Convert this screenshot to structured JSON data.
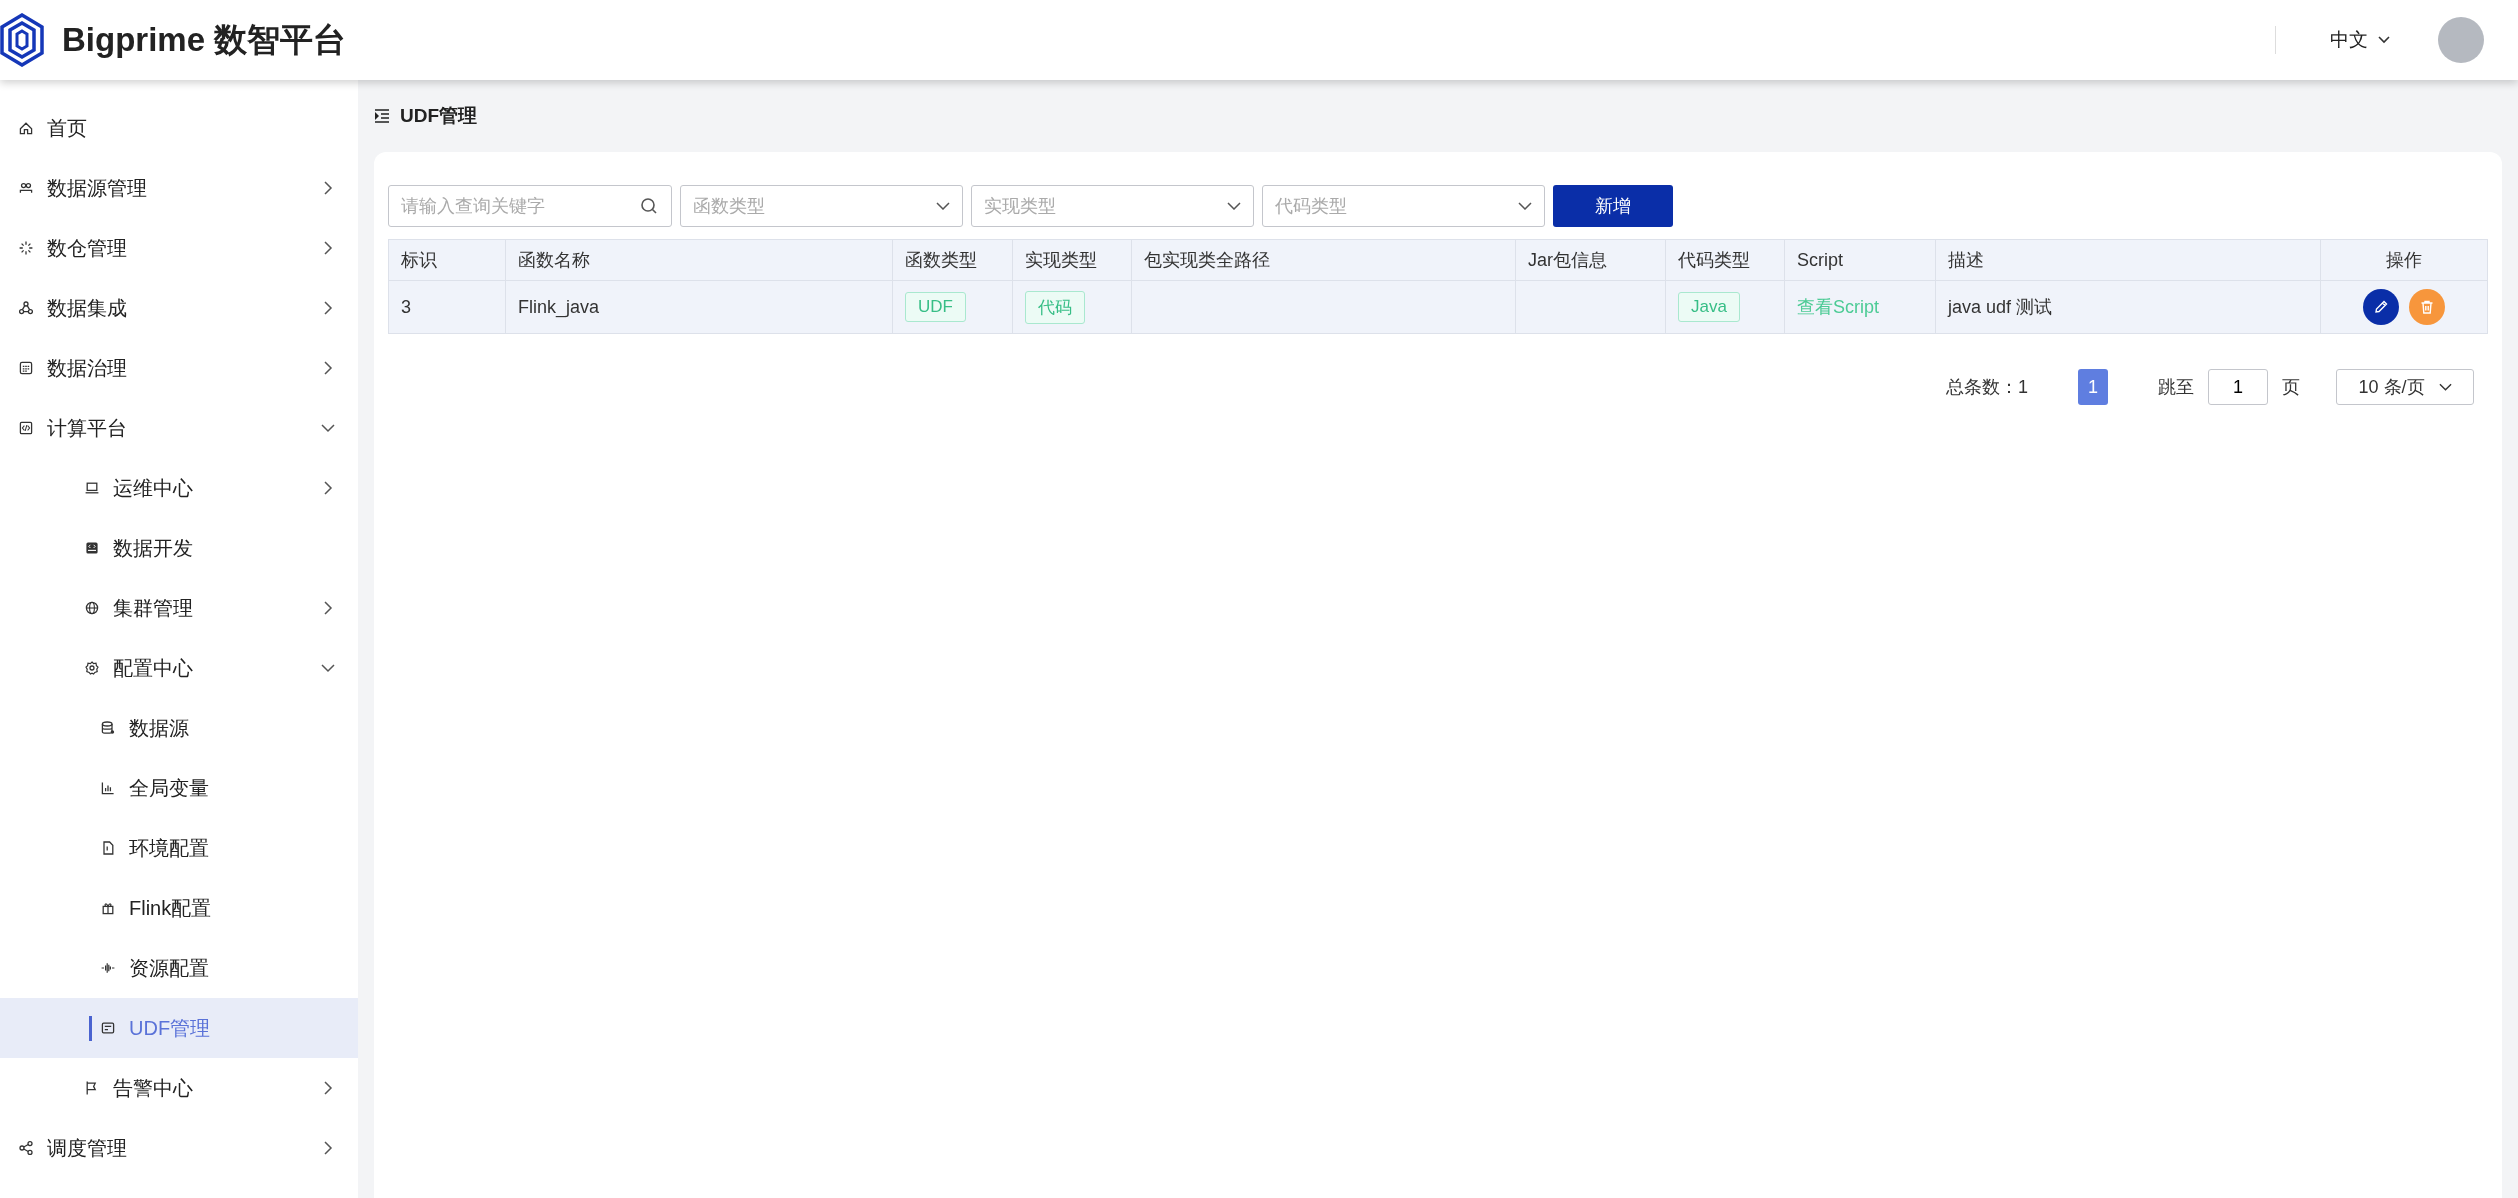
{
  "header": {
    "title": "Bigprime 数智平台",
    "language": "中文"
  },
  "sidebar": {
    "items": [
      {
        "label": "首页",
        "selected": false
      },
      {
        "label": "数据源管理",
        "expanded": false,
        "selected": false
      },
      {
        "label": "数仓管理",
        "expanded": false,
        "selected": false
      },
      {
        "label": "数据集成",
        "expanded": false,
        "selected": false
      },
      {
        "label": "数据治理",
        "expanded": false,
        "selected": false
      },
      {
        "label": "计算平台",
        "expanded": true,
        "selected": false,
        "children": [
          {
            "label": "运维中心",
            "expanded": false,
            "selected": false
          },
          {
            "label": "数据开发",
            "selected": false
          },
          {
            "label": "集群管理",
            "expanded": false,
            "selected": false
          },
          {
            "label": "配置中心",
            "expanded": true,
            "selected": false,
            "children": [
              {
                "label": "数据源",
                "selected": false
              },
              {
                "label": "全局变量",
                "selected": false
              },
              {
                "label": "环境配置",
                "selected": false
              },
              {
                "label": "Flink配置",
                "selected": false
              },
              {
                "label": "资源配置",
                "selected": false
              },
              {
                "label": "UDF管理",
                "selected": true
              }
            ]
          },
          {
            "label": "告警中心",
            "expanded": false,
            "selected": false
          }
        ]
      },
      {
        "label": "调度管理",
        "expanded": false,
        "selected": false
      }
    ]
  },
  "page_title": "UDF管理",
  "filters": {
    "search": {
      "placeholder": "请输入查询关键字"
    },
    "selects": [
      {
        "placeholder": "函数类型"
      },
      {
        "placeholder": "实现类型"
      },
      {
        "placeholder": "代码类型"
      }
    ],
    "add_button": "新增"
  },
  "table": {
    "columns": [
      {
        "label": "标识",
        "kind": "text"
      },
      {
        "label": "函数名称",
        "kind": "text"
      },
      {
        "label": "函数类型",
        "kind": "tag"
      },
      {
        "label": "实现类型",
        "kind": "tag"
      },
      {
        "label": "包实现类全路径",
        "kind": "text"
      },
      {
        "label": "Jar包信息",
        "kind": "text"
      },
      {
        "label": "代码类型",
        "kind": "tag"
      },
      {
        "label": "Script",
        "kind": "link"
      },
      {
        "label": "描述",
        "kind": "text"
      },
      {
        "label": "操作",
        "kind": "actions"
      }
    ],
    "rows": [
      {
        "cells": [
          "3",
          "Flink_java",
          "UDF",
          "代码",
          null,
          null,
          "Java",
          "查看Script",
          "java udf 测试",
          null
        ]
      }
    ]
  },
  "pagination": {
    "total": "总条数：1",
    "pages": [
      {
        "label": "1",
        "selected": true
      }
    ],
    "jump_label": "跳至",
    "jump_value": "1",
    "jump_unit": "页",
    "page_size": "10 条/页"
  }
}
